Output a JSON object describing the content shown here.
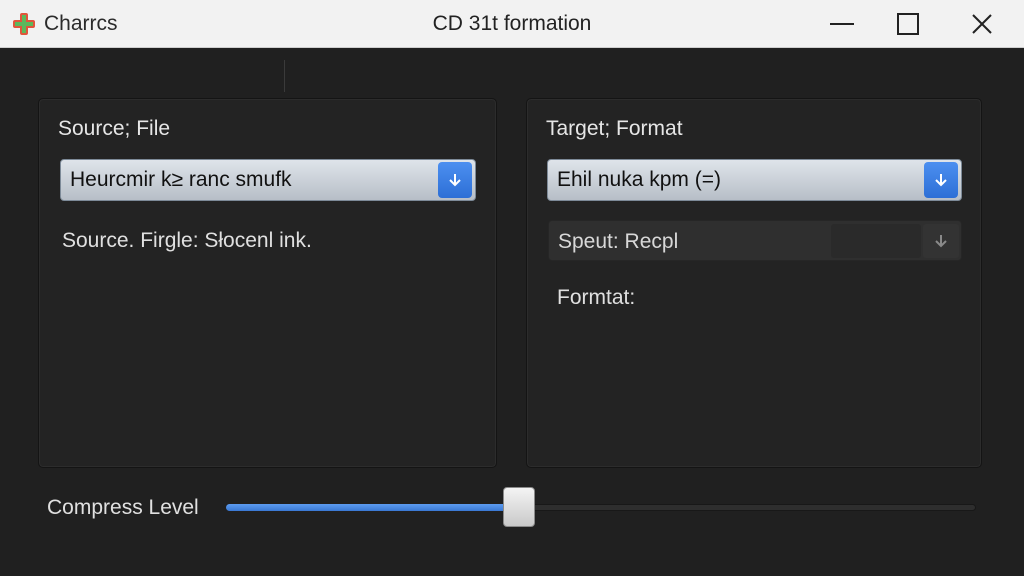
{
  "titlebar": {
    "app_name": "Charrcs",
    "title": "CD 31t formation",
    "icon": "app-cross-icon",
    "controls": [
      "minimize-icon",
      "maximize-icon",
      "close-icon"
    ]
  },
  "source_panel": {
    "title": "Source; File",
    "combo_value": "Heurcmir k≥ ranc smufk",
    "info_text": "Source. Firgle: Słocenl  ink."
  },
  "target_panel": {
    "title": "Target; Format",
    "combo_value": "Ehil nuka kpm (=)",
    "speed_label": "Speut: Recpl",
    "format_label": "Formtat:"
  },
  "compress": {
    "label": "Compress Level",
    "value_fraction": 0.39
  },
  "colors": {
    "accent": "#3a78d3",
    "background": "#202020",
    "titlebar": "#f2f2f2"
  }
}
